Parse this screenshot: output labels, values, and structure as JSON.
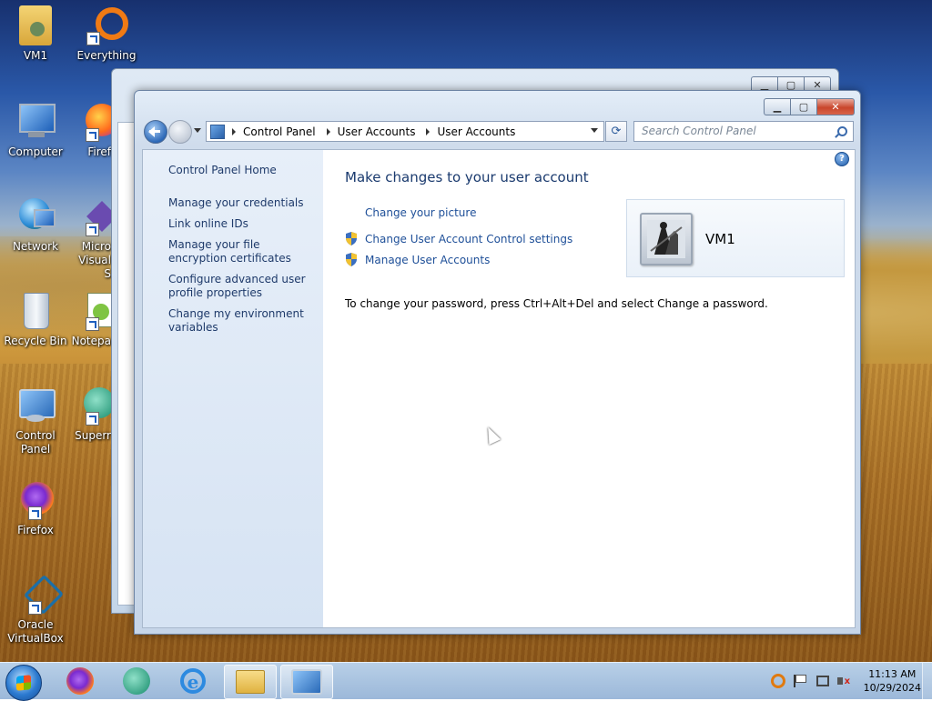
{
  "desktop": {
    "icons": [
      {
        "label": "VM1"
      },
      {
        "label": "Everything"
      },
      {
        "label": "Computer"
      },
      {
        "label": "Firef"
      },
      {
        "label": "Network"
      },
      {
        "label": "Micro Visual S"
      },
      {
        "label": "Recycle Bin"
      },
      {
        "label": "Notepa"
      },
      {
        "label": "Control Panel"
      },
      {
        "label": "Superr"
      },
      {
        "label": "Firefox"
      },
      {
        "label": "Oracle VirtualBox"
      }
    ]
  },
  "window": {
    "controls": {
      "minimize": "▁",
      "maximize": "▢",
      "close": "✕"
    },
    "breadcrumbs": [
      "Control Panel",
      "User Accounts",
      "User Accounts"
    ],
    "search_placeholder": "Search Control Panel",
    "sidebar": {
      "home": "Control Panel Home",
      "links": [
        "Manage your credentials",
        "Link online IDs",
        "Manage your file encryption certificates",
        "Configure advanced user profile properties",
        "Change my environment variables"
      ]
    },
    "main": {
      "heading": "Make changes to your user account",
      "tasks": [
        "Change your picture",
        "Change User Account Control settings",
        "Manage User Accounts"
      ],
      "password_note": "To change your password, press Ctrl+Alt+Del and select Change a password.",
      "user_name": "VM1"
    }
  },
  "taskbar": {
    "clock_time": "11:13 AM",
    "clock_date": "10/29/2024"
  }
}
